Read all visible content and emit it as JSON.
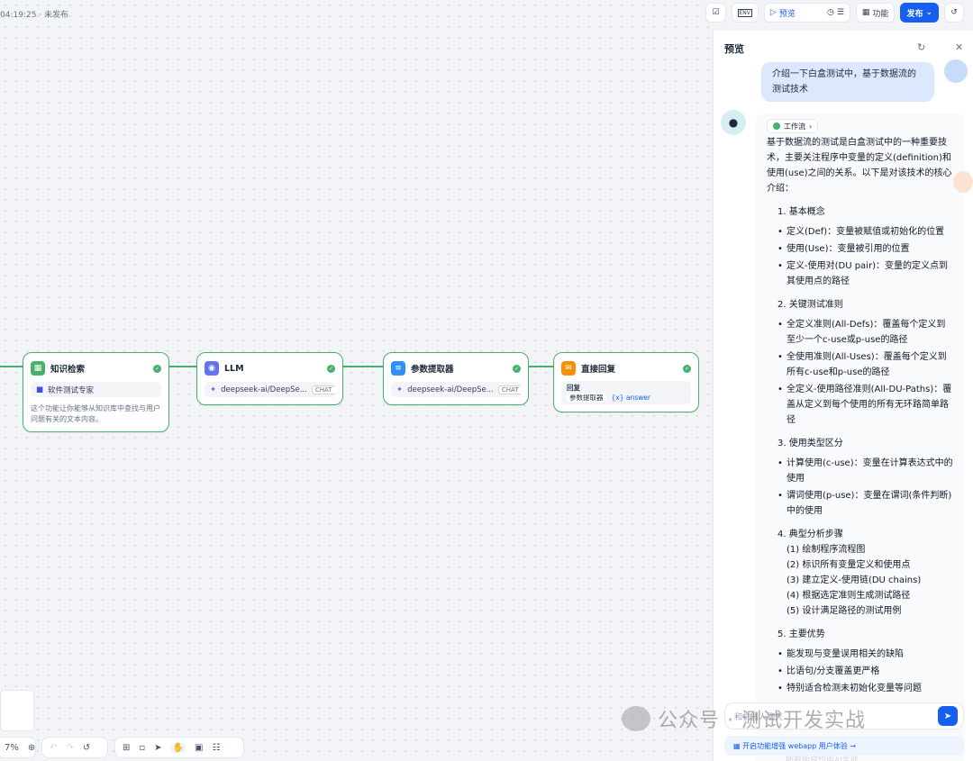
{
  "status": {
    "time": "04:19:25",
    "state": "未发布",
    "separator": "·"
  },
  "toolbar": {
    "env_label": "ENV",
    "preview_label": "预览",
    "features_label": "功能",
    "publish_label": "发布"
  },
  "nodes": [
    {
      "title": "知识检索",
      "row": "软件测试专家",
      "desc": "这个功能让你能够从知识库中查找与用户问题有关的文本内容。",
      "color": "#47b16b"
    },
    {
      "title": "LLM",
      "row": "deepseek-ai/DeepSe...",
      "badge": "CHAT",
      "color": "#6172f3"
    },
    {
      "title": "参数提取器",
      "row": "deepseek-ai/DeepSe...",
      "badge": "CHAT",
      "color": "#2e90fa"
    },
    {
      "title": "直接回复",
      "reply_label": "回复",
      "ref_node": "参数提取器",
      "ref_var": "{x} answer",
      "color": "#f79009"
    }
  ],
  "zoom": "7%",
  "panel": {
    "title": "预览",
    "user_message": "介绍一下白盒测试中，基于数据流的测试技术",
    "workflow_badge": "工作流",
    "answer_intro": "基于数据流的测试是白盒测试中的一种重要技术，主要关注程序中变量的定义(definition)和使用(use)之间的关系。以下是对该技术的核心介绍：",
    "sections": [
      {
        "heading": "1. 基本概念",
        "items": [
          "定义(Def)：变量被赋值或初始化的位置",
          "使用(Use)：变量被引用的位置",
          "定义-使用对(DU pair)：变量的定义点到其使用点的路径"
        ]
      },
      {
        "heading": "2. 关键测试准则",
        "items": [
          "全定义准则(All-Defs)：覆盖每个定义到至少一个c-use或p-use的路径",
          "全使用准则(All-Uses)：覆盖每个定义到所有c-use和p-use的路径",
          "全定义-使用路径准则(All-DU-Paths)：覆盖从定义到每个使用的所有无环路简单路径"
        ]
      },
      {
        "heading": "3. 使用类型区分",
        "items": [
          "计算使用(c-use)：变量在计算表达式中的使用",
          "谓词使用(p-use)：变量在谓词(条件判断)中的使用"
        ]
      },
      {
        "heading": "4. 典型分析步骤",
        "steps": [
          "(1) 绘制程序流程图",
          "(2) 标识所有变量定义和使用点",
          "(3) 建立定义-使用链(DU chains)",
          "(4) 根据选定准则生成测试路径",
          "(5) 设计满足路径的测试用例"
        ]
      },
      {
        "heading": "5. 主要优势",
        "items": [
          "能发现与变量误用相关的缺陷",
          "比语句/分支覆盖更严格",
          "特别适合检测未初始化变量等问题"
        ]
      }
    ],
    "input_placeholder": "和机器人聊天",
    "enhance_text": "开启功能增强 webapp 用户体验",
    "faded_text": "所有内容均由AI生成"
  },
  "watermark": "公众号 · 测试开发实战",
  "colors": {
    "accent": "#155eef",
    "success": "#47b16b"
  }
}
